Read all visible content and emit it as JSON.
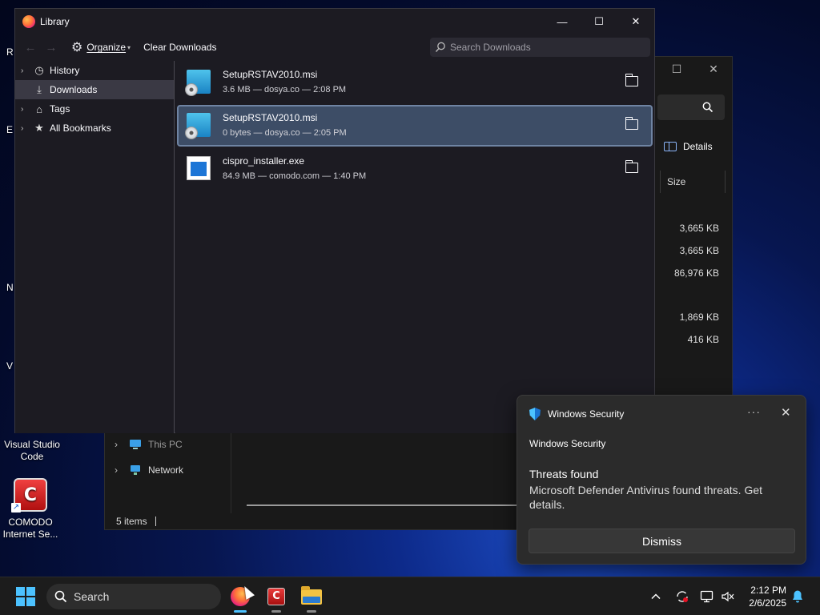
{
  "desktop": {
    "icons": [
      {
        "label_line1": "Visual Studio",
        "label_line2": "Code"
      },
      {
        "label_line1": "COMODO",
        "label_line2": "Internet Se..."
      }
    ],
    "edge_fragments": [
      "R",
      "E",
      "N",
      "V"
    ]
  },
  "explorer": {
    "details_label": "Details",
    "size_header": "Size",
    "sizes": [
      "3,665 KB",
      "3,665 KB",
      "86,976 KB",
      "1,869 KB",
      "416 KB"
    ],
    "nav": [
      {
        "label": "This PC",
        "icon": "computer-icon"
      },
      {
        "label": "Network",
        "icon": "network-icon"
      }
    ],
    "status": "5 items"
  },
  "library": {
    "title": "Library",
    "toolbar": {
      "organize": "Organize",
      "clear": "Clear Downloads"
    },
    "search_placeholder": "Search Downloads",
    "sidebar": [
      {
        "label": "History",
        "icon": "clock-icon",
        "expandable": true,
        "selected": false
      },
      {
        "label": "Downloads",
        "icon": "download-icon",
        "expandable": false,
        "selected": true
      },
      {
        "label": "Tags",
        "icon": "tag-icon",
        "expandable": true,
        "selected": false
      },
      {
        "label": "All Bookmarks",
        "icon": "star-icon",
        "expandable": true,
        "selected": false
      }
    ],
    "downloads": [
      {
        "name": "SetupRSTAV2010.msi",
        "meta": "3.6 MB — dosya.co — 2:08 PM",
        "type": "msi",
        "selected": false
      },
      {
        "name": "SetupRSTAV2010.msi",
        "meta": "0 bytes — dosya.co — 2:05 PM",
        "type": "msi",
        "selected": true
      },
      {
        "name": "cispro_installer.exe",
        "meta": "84.9 MB — comodo.com — 1:40 PM",
        "type": "exe",
        "selected": false
      }
    ]
  },
  "toast": {
    "app": "Windows Security",
    "source": "Windows Security",
    "title": "Threats found",
    "body": "Microsoft Defender Antivirus found threats. Get details.",
    "dismiss": "Dismiss",
    "more": "···"
  },
  "taskbar": {
    "search": "Search",
    "time": "2:12 PM",
    "date": "2/6/2025",
    "accent": "#4cc2ff"
  }
}
